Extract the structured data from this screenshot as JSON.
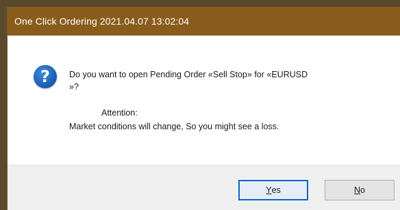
{
  "window": {
    "title": "One Click Ordering 2021.04.07 13:02:04",
    "accent_color": "#8a5c1c"
  },
  "message": {
    "icon": "question-icon",
    "line1": "Do you want to open Pending Order «Sell Stop» for «EURUSD",
    "line2": "»?",
    "attention": "Attention:",
    "warning": "Market conditions will change, So you might see a loss."
  },
  "buttons": {
    "yes_accel": "Y",
    "yes_rest": "es",
    "no_accel": "N",
    "no_rest": "o"
  }
}
